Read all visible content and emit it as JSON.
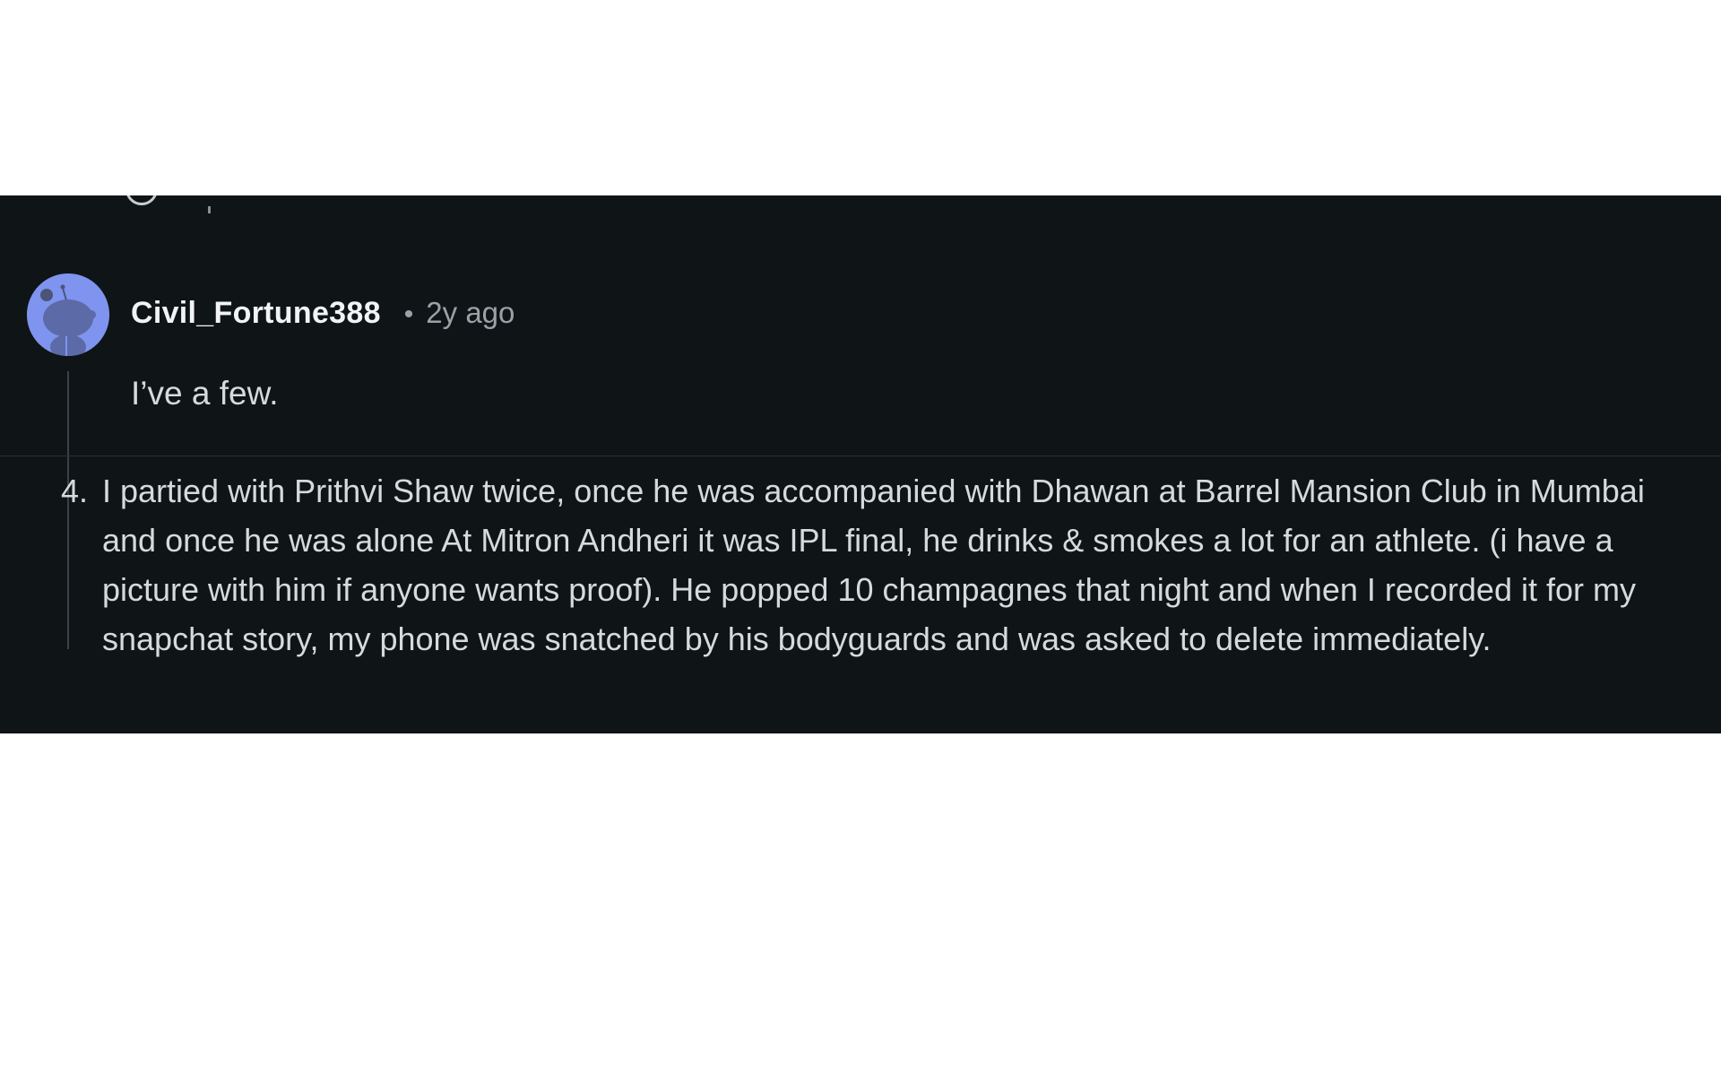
{
  "comment": {
    "username": "Civil_Fortune388",
    "separator": "•",
    "timestamp": "2y ago",
    "body": "I’ve a few.",
    "avatar_icon": "reddit-snoo-avatar-icon",
    "avatar_color": "#7e94ee"
  },
  "list": {
    "items": [
      {
        "number": "4.",
        "text": "I partied with Prithvi Shaw twice, once he was accompanied with Dhawan at Barrel Mansion Club in Mumbai and once he was alone At Mitron Andheri it was IPL final, he drinks & smokes a lot for an athlete. (i have a picture with him if anyone wants proof). He popped 10 champagnes that night and when I recorded it for my snapchat story, my phone was snatched by his bodyguards and was asked to delete immediately."
      }
    ]
  },
  "colors": {
    "panel_background": "#0f1417",
    "text_primary": "#f1f3f4",
    "text_body": "#d7dadc",
    "text_muted": "#9aa2a8"
  }
}
